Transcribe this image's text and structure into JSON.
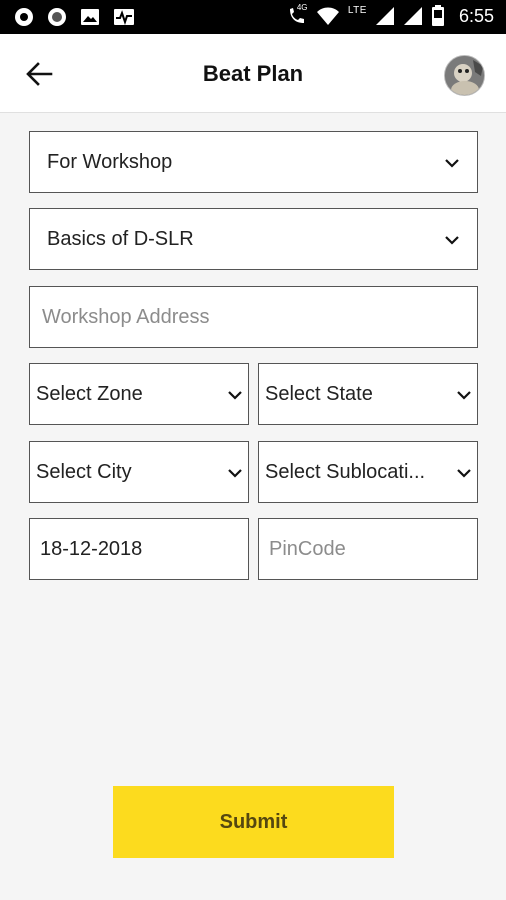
{
  "status_bar": {
    "time": "6:55",
    "network_label": "LTE",
    "badge_4g": "4G",
    "icons": [
      "circle-notification-icon",
      "circle-notification-icon",
      "image-icon",
      "pulse-icon",
      "wifi-call-icon",
      "wifi-icon",
      "signal-icon",
      "signal-icon",
      "battery-icon"
    ]
  },
  "header": {
    "title": "Beat Plan",
    "back_icon": "arrow-left-icon",
    "avatar_icon": "user-avatar"
  },
  "form": {
    "event_type": {
      "value": "For Workshop"
    },
    "workshop_topic": {
      "value": "Basics of D-SLR"
    },
    "workshop_address": {
      "placeholder": "Workshop Address",
      "value": ""
    },
    "zone": {
      "value": "Select Zone"
    },
    "state": {
      "value": "Select State"
    },
    "city": {
      "value": "Select City"
    },
    "sublocation": {
      "value": "Select Sublocati..."
    },
    "date": {
      "value": "18-12-2018"
    },
    "pincode": {
      "placeholder": "PinCode",
      "value": ""
    }
  },
  "submit_label": "Submit",
  "colors": {
    "accent": "#fcdb1e",
    "submit_text": "#554710",
    "status_bar": "#000000",
    "background": "#f5f5f5"
  }
}
